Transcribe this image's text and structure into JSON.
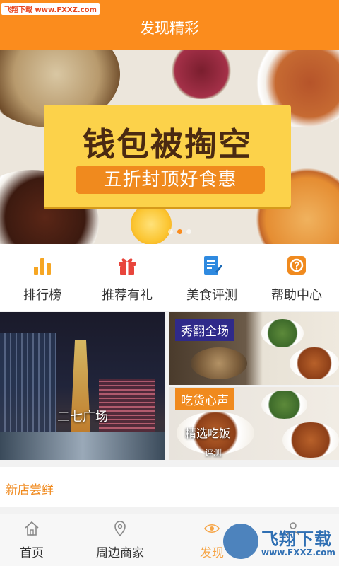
{
  "watermark_top": "飞翔下载 www.FXXZ.com",
  "header": {
    "title": "发现精彩"
  },
  "banner": {
    "headline": "钱包被掏空",
    "subline": "五折封顶好食惠",
    "slides": 3,
    "active_slide": 2
  },
  "menu": [
    {
      "label": "排行榜",
      "icon": "bar-chart-icon",
      "color": "#f6a623"
    },
    {
      "label": "推荐有礼",
      "icon": "gift-icon",
      "color": "#e8453c"
    },
    {
      "label": "美食评测",
      "icon": "document-edit-icon",
      "color": "#2f8ae0"
    },
    {
      "label": "帮助中心",
      "icon": "question-icon",
      "color": "#f08a1e"
    }
  ],
  "tiles": {
    "big_caption": "二七广场",
    "right_top_caption": "秀翻全场",
    "right_bottom_caption": "吃货心声",
    "right_bottom_sub": "精选吃饭",
    "right_bottom_small": "评测"
  },
  "new_shops": {
    "label": "新店尝鲜"
  },
  "tabbar": [
    {
      "label": "首页",
      "icon": "home-icon",
      "active": false
    },
    {
      "label": "周边商家",
      "icon": "location-icon",
      "active": false
    },
    {
      "label": "发现",
      "icon": "eye-icon",
      "active": true
    },
    {
      "label": "",
      "icon": "user-icon",
      "active": false
    }
  ],
  "watermark_bottom": {
    "name": "飞翔下载",
    "url": "www.FXXZ.com"
  },
  "colors": {
    "accent": "#fb8c1d",
    "active_tab": "#f6a445"
  }
}
